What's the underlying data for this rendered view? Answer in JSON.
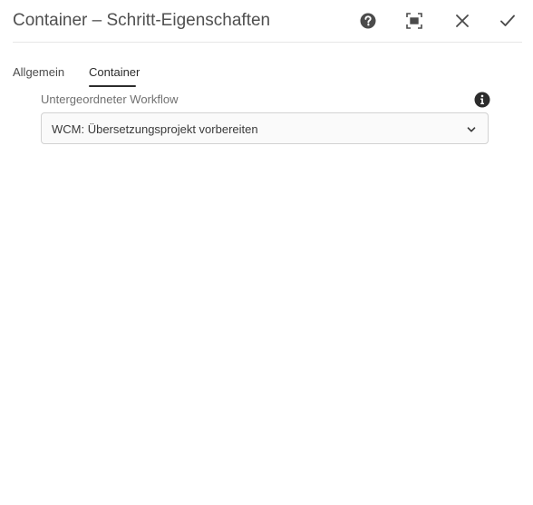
{
  "dialog": {
    "title": "Container – Schritt-Eigenschaften",
    "actions": {
      "help_icon": "help-circle-icon",
      "fullscreen_icon": "fullscreen-icon",
      "close_icon": "close-icon",
      "done_icon": "checkmark-icon"
    }
  },
  "tabs": [
    {
      "label": "Allgemein",
      "selected": false
    },
    {
      "label": "Container",
      "selected": true
    }
  ],
  "form": {
    "subworkflow": {
      "label": "Untergeordneter Workflow",
      "info_icon": "info-icon",
      "selected_value": "WCM: Übersetzungsprojekt vorbereiten",
      "chevron_icon": "chevron-down-icon"
    }
  },
  "colors": {
    "text": "#4b4b4b",
    "label": "#707070",
    "border": "#d2d2d2",
    "field_background": "#fafafa",
    "active_tab": "#2c2c2c"
  }
}
